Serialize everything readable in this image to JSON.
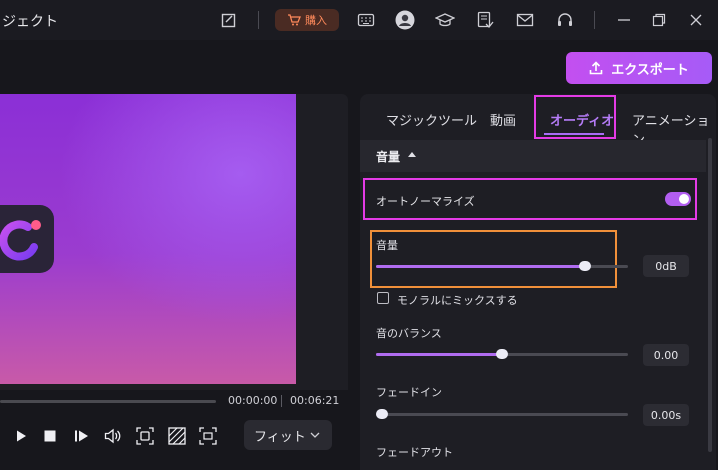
{
  "titlebar": {
    "title": "ジェクト",
    "buy_label": "購入"
  },
  "toolbar": {
    "export_label": "エクスポート"
  },
  "player": {
    "time_current": "00:00:00",
    "time_total": "00:06:21",
    "fit_label": "フィット"
  },
  "panel": {
    "tabs": [
      {
        "label": "マジックツール"
      },
      {
        "label": "動画"
      },
      {
        "label": "オーディオ",
        "active": true
      },
      {
        "label": "アニメーション"
      }
    ],
    "section_title": "音量",
    "auto_normalize": {
      "label": "オートノーマライズ",
      "on": true
    },
    "volume": {
      "label": "音量",
      "value_text": "0dB",
      "level": 0.83
    },
    "mono_mix": {
      "label": "モノラルにミックスする",
      "checked": false
    },
    "balance": {
      "label": "音のバランス",
      "value_text": "0.00",
      "level": 0.5
    },
    "fade_in": {
      "label": "フェードイン",
      "value_text": "0.00s",
      "level": 0.0
    },
    "fade_out": {
      "label": "フェードアウト"
    }
  },
  "colors": {
    "accent": "#a86cf5",
    "highlight_magenta": "#e43be6",
    "highlight_orange": "#f0903a",
    "buy_text": "#ff8a5b"
  }
}
